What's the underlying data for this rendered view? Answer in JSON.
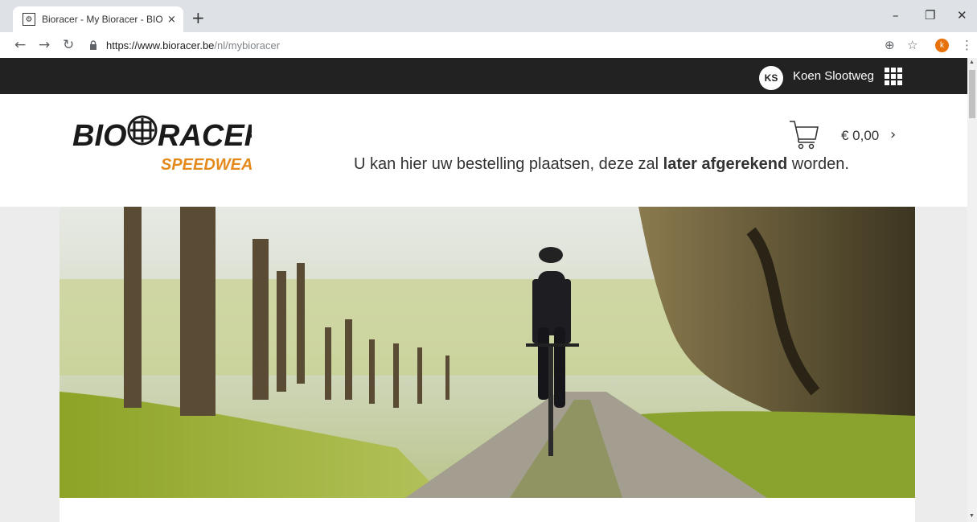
{
  "browser": {
    "tab_title": "Bioracer - My Bioracer - BIORACER",
    "tab_close": "×",
    "new_tab": "+",
    "url_host": "https://www.bioracer.be",
    "url_path": "/nl/mybioracer",
    "profile_initial": "k",
    "window_controls": {
      "minimize": "–",
      "restore": "❐",
      "close": "✕"
    }
  },
  "topbar": {
    "avatar_initials": "KS",
    "user_name": "Koen Slootweg"
  },
  "logo": {
    "line1_left": "BIO",
    "line1_right": "RACER",
    "line2": "SPEEDWEAR"
  },
  "cart": {
    "amount": "€ 0,00",
    "chevron": "›"
  },
  "info": {
    "text_pre": "U kan hier uw bestelling plaatsen, deze zal ",
    "text_bold": "later afgerekend",
    "text_post": " worden."
  },
  "colors": {
    "topbar": "#222222",
    "logo_orange": "#e48a1c",
    "page_bg": "#ececec"
  },
  "icons": [
    "favicon-icon",
    "back-icon",
    "forward-icon",
    "reload-icon",
    "lock-icon",
    "zoom-icon",
    "star-icon",
    "menu-icon",
    "apps-grid-icon",
    "cart-icon",
    "chevron-right-icon"
  ]
}
